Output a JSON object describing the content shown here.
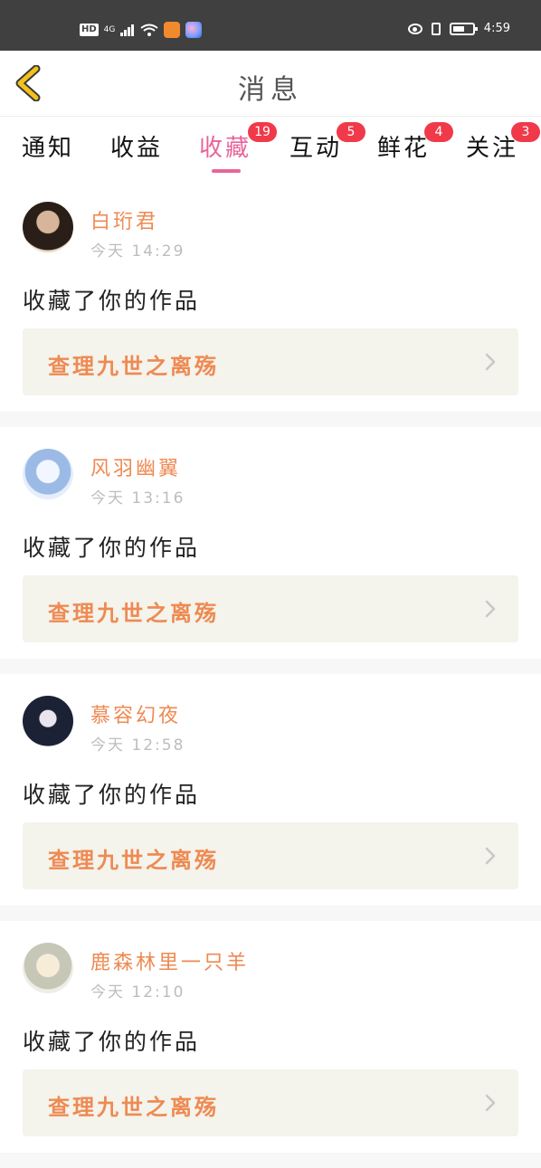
{
  "status_bar": {
    "left_label": "HD",
    "signal_label": "4G",
    "time": "4:59",
    "icons": [
      "hd-icon",
      "signal-icon",
      "wifi-icon",
      "app-icon",
      "app-icon",
      "eye-icon",
      "vibrate-icon",
      "battery-icon"
    ]
  },
  "header": {
    "title": "消息",
    "back_icon": "chevron-left-icon"
  },
  "tabs": [
    {
      "label": "通知",
      "badge": ""
    },
    {
      "label": "收益",
      "badge": ""
    },
    {
      "label": "收藏",
      "badge": "19",
      "active": true
    },
    {
      "label": "互动",
      "badge": "5"
    },
    {
      "label": "鲜花",
      "badge": "4"
    },
    {
      "label": "关注",
      "badge": "3"
    }
  ],
  "messages": [
    {
      "username": "白珩君",
      "time": "今天 14:29",
      "action": "收藏了你的作品",
      "work_title": "查理九世之离殇"
    },
    {
      "username": "风羽幽翼",
      "time": "今天 13:16",
      "action": "收藏了你的作品",
      "work_title": "查理九世之离殇"
    },
    {
      "username": "慕容幻夜",
      "time": "今天 12:58",
      "action": "收藏了你的作品",
      "work_title": "查理九世之离殇"
    },
    {
      "username": "鹿森林里一只羊",
      "time": "今天 12:10",
      "action": "收藏了你的作品",
      "work_title": "查理九世之离殇"
    }
  ],
  "colors": {
    "accent_pink": "#e8649b",
    "name_orange": "#ee8a52",
    "badge_red": "#f03a4a",
    "back_yellow": "#f2c21a"
  }
}
